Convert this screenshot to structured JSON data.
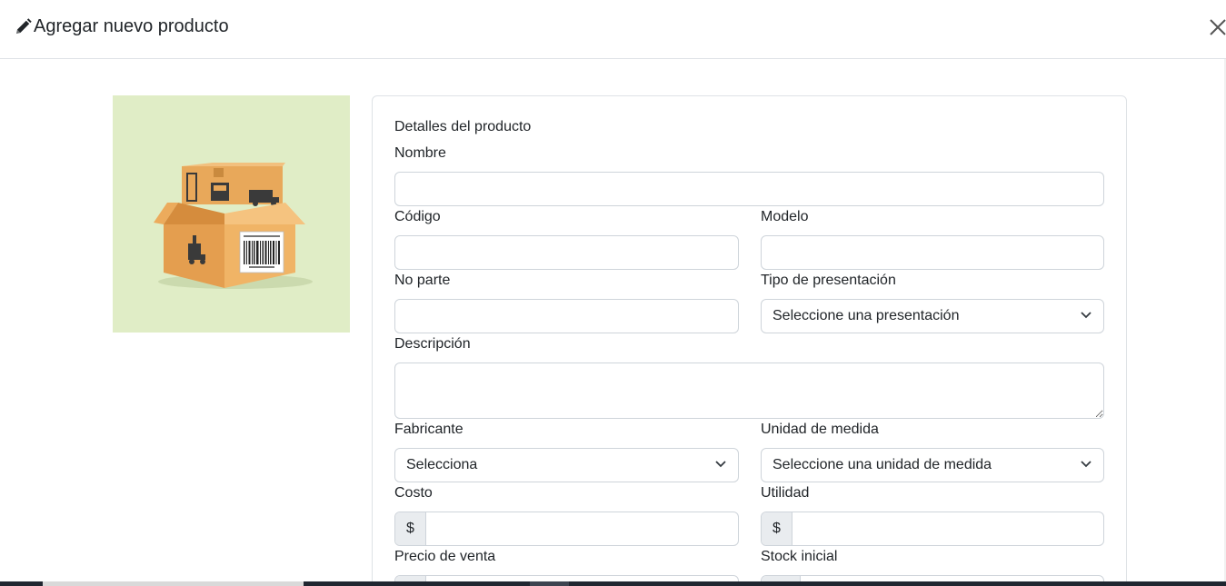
{
  "modal": {
    "title": "Agregar nuevo producto",
    "title_icon": "pencil-icon",
    "close_icon": "close-icon"
  },
  "image": {
    "description_icon": "product-box-icon",
    "background_color": "#e0edc6"
  },
  "form": {
    "section_title": "Detalles del producto",
    "nombre": {
      "label": "Nombre",
      "value": ""
    },
    "codigo": {
      "label": "Código",
      "value": ""
    },
    "modelo": {
      "label": "Modelo",
      "value": ""
    },
    "no_parte": {
      "label": "No parte",
      "value": ""
    },
    "tipo_presentacion": {
      "label": "Tipo de presentación",
      "selected": "Seleccione una presentación"
    },
    "descripcion": {
      "label": "Descripción",
      "value": ""
    },
    "fabricante": {
      "label": "Fabricante",
      "selected": "Selecciona"
    },
    "unidad_medida": {
      "label": "Unidad de medida",
      "selected": "Seleccione una unidad de medida"
    },
    "costo": {
      "label": "Costo",
      "prefix": "$",
      "value": ""
    },
    "utilidad": {
      "label": "Utilidad",
      "prefix": "$",
      "value": ""
    },
    "precio_venta": {
      "label": "Precio de venta"
    },
    "stock_inicial": {
      "label": "Stock inicial"
    }
  },
  "colors": {
    "border": "#ced4da",
    "addon_bg": "#e9ecef",
    "text": "#212529"
  }
}
